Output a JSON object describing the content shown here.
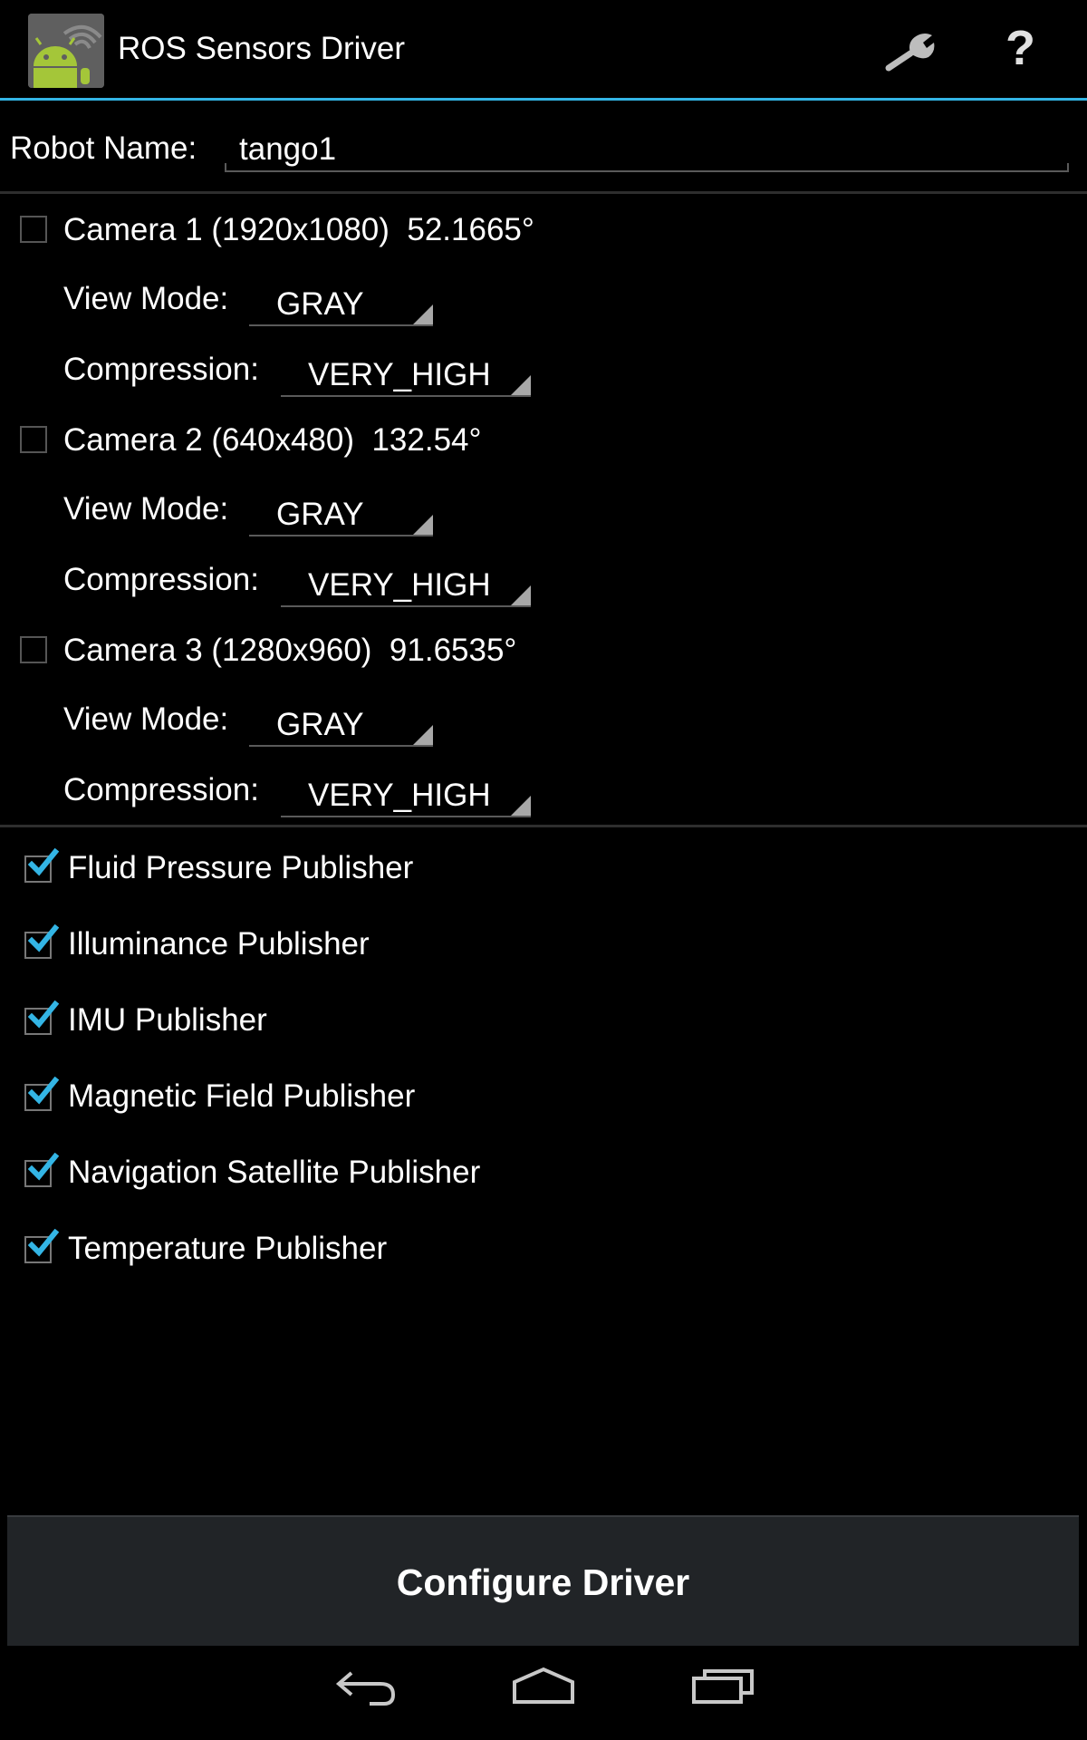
{
  "app": {
    "title": "ROS Sensors Driver"
  },
  "actions": {
    "settings_icon": "wrench-icon",
    "help_label": "?"
  },
  "robot": {
    "label": "Robot Name:",
    "value": "tango1"
  },
  "cameras": [
    {
      "label": "Camera 1 (1920x1080)  52.1665°",
      "checked": false,
      "view_mode_label": "View Mode:",
      "view_mode": "GRAY",
      "compression_label": "Compression:",
      "compression": "VERY_HIGH"
    },
    {
      "label": "Camera 2 (640x480)  132.54°",
      "checked": false,
      "view_mode_label": "View Mode:",
      "view_mode": "GRAY",
      "compression_label": "Compression:",
      "compression": "VERY_HIGH"
    },
    {
      "label": "Camera 3 (1280x960)  91.6535°",
      "checked": false,
      "view_mode_label": "View Mode:",
      "view_mode": "GRAY",
      "compression_label": "Compression:",
      "compression": "VERY_HIGH"
    }
  ],
  "publishers": [
    {
      "label": "Fluid Pressure Publisher",
      "checked": true
    },
    {
      "label": "Illuminance Publisher",
      "checked": true
    },
    {
      "label": "IMU Publisher",
      "checked": true
    },
    {
      "label": "Magnetic Field Publisher",
      "checked": true
    },
    {
      "label": "Navigation Satellite Publisher",
      "checked": true
    },
    {
      "label": "Temperature Publisher",
      "checked": true
    }
  ],
  "configure_button": {
    "label": "Configure Driver"
  },
  "colors": {
    "accent": "#33b5e5",
    "background": "#000000",
    "button_bg": "#212427"
  }
}
